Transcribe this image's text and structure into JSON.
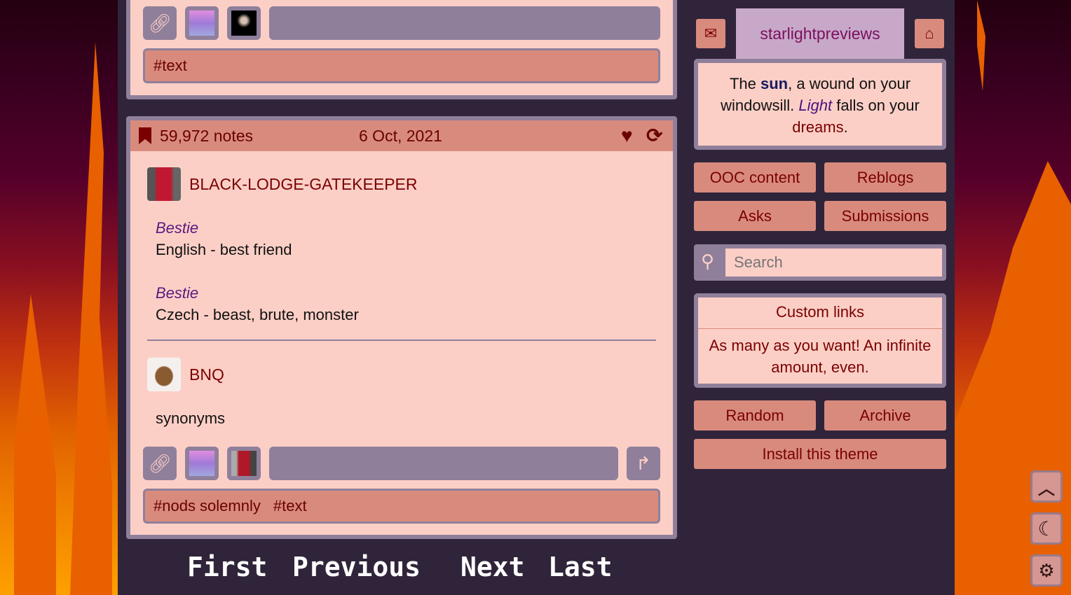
{
  "posts": [
    {
      "tags": [
        "#text"
      ]
    },
    {
      "notes": "59,972 notes",
      "date": "6 Oct, 2021",
      "entries": [
        {
          "user": "BLACK-LODGE-GATEKEEPER",
          "content": [
            {
              "term": "Bestie",
              "def": "English - best friend"
            },
            {
              "term": "Bestie",
              "def": "Czech - beast, brute, monster"
            }
          ]
        },
        {
          "user": "BNQ",
          "text": "synonyms"
        }
      ],
      "tags": [
        "#nods solemnly",
        "#text"
      ]
    }
  ],
  "sidebar": {
    "blog_title": "starlightpreviews",
    "description": {
      "p1": "The ",
      "sun": "sun",
      "p2": ", a wound on your windowsill. ",
      "light": "Light",
      "p3": " falls on your ",
      "dreams": "dreams",
      "p4": "."
    },
    "buttons": [
      "OOC content",
      "Reblogs",
      "Asks",
      "Submissions"
    ],
    "search_placeholder": "Search",
    "custom_links": {
      "title": "Custom links",
      "text": "As many as you want! An infinite amount, even."
    },
    "bottom_buttons": [
      "Random",
      "Archive"
    ],
    "install": "Install this theme"
  },
  "pagination": [
    "First",
    "Previous",
    "Next",
    "Last"
  ],
  "colors": {
    "panel": "#fccfc6",
    "accent": "#d88b7d",
    "border": "#8f7f9b",
    "bg": "#30243a",
    "text": "#7a0000"
  }
}
